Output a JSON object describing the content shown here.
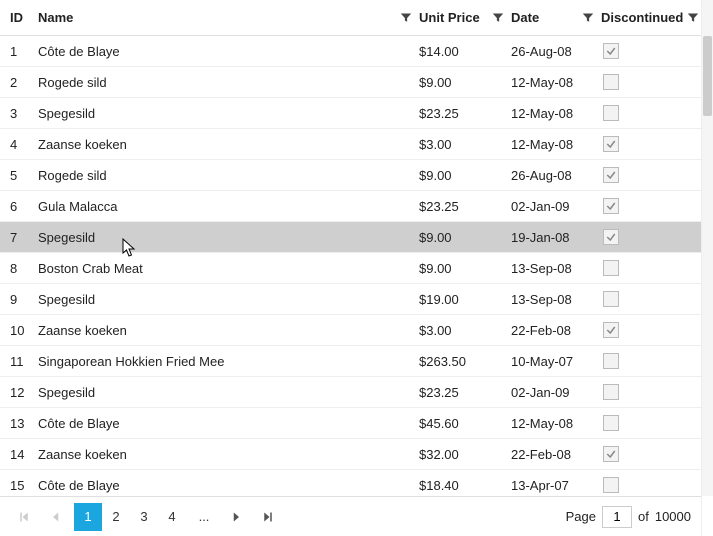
{
  "columns": {
    "id": "ID",
    "name": "Name",
    "price": "Unit Price",
    "date": "Date",
    "disc": "Discontinued"
  },
  "rows": [
    {
      "id": "1",
      "name": "Côte de Blaye",
      "price": "$14.00",
      "date": "26-Aug-08",
      "disc": true,
      "hover": false
    },
    {
      "id": "2",
      "name": "Rogede sild",
      "price": "$9.00",
      "date": "12-May-08",
      "disc": false,
      "hover": false
    },
    {
      "id": "3",
      "name": "Spegesild",
      "price": "$23.25",
      "date": "12-May-08",
      "disc": false,
      "hover": false
    },
    {
      "id": "4",
      "name": "Zaanse koeken",
      "price": "$3.00",
      "date": "12-May-08",
      "disc": true,
      "hover": false
    },
    {
      "id": "5",
      "name": "Rogede sild",
      "price": "$9.00",
      "date": "26-Aug-08",
      "disc": true,
      "hover": false
    },
    {
      "id": "6",
      "name": "Gula Malacca",
      "price": "$23.25",
      "date": "02-Jan-09",
      "disc": true,
      "hover": false
    },
    {
      "id": "7",
      "name": "Spegesild",
      "price": "$9.00",
      "date": "19-Jan-08",
      "disc": true,
      "hover": true
    },
    {
      "id": "8",
      "name": "Boston Crab Meat",
      "price": "$9.00",
      "date": "13-Sep-08",
      "disc": false,
      "hover": false
    },
    {
      "id": "9",
      "name": "Spegesild",
      "price": "$19.00",
      "date": "13-Sep-08",
      "disc": false,
      "hover": false
    },
    {
      "id": "10",
      "name": "Zaanse koeken",
      "price": "$3.00",
      "date": "22-Feb-08",
      "disc": true,
      "hover": false
    },
    {
      "id": "11",
      "name": "Singaporean Hokkien Fried Mee",
      "price": "$263.50",
      "date": "10-May-07",
      "disc": false,
      "hover": false
    },
    {
      "id": "12",
      "name": "Spegesild",
      "price": "$23.25",
      "date": "02-Jan-09",
      "disc": false,
      "hover": false
    },
    {
      "id": "13",
      "name": "Côte de Blaye",
      "price": "$45.60",
      "date": "12-May-08",
      "disc": false,
      "hover": false
    },
    {
      "id": "14",
      "name": "Zaanse koeken",
      "price": "$32.00",
      "date": "22-Feb-08",
      "disc": true,
      "hover": false
    },
    {
      "id": "15",
      "name": "Côte de Blaye",
      "price": "$18.40",
      "date": "13-Apr-07",
      "disc": false,
      "hover": false
    }
  ],
  "pager": {
    "pages": [
      "1",
      "2",
      "3",
      "4"
    ],
    "ellipsis": "...",
    "active": "1",
    "page_label": "Page",
    "page_value": "1",
    "of_label": "of",
    "total": "10000"
  }
}
